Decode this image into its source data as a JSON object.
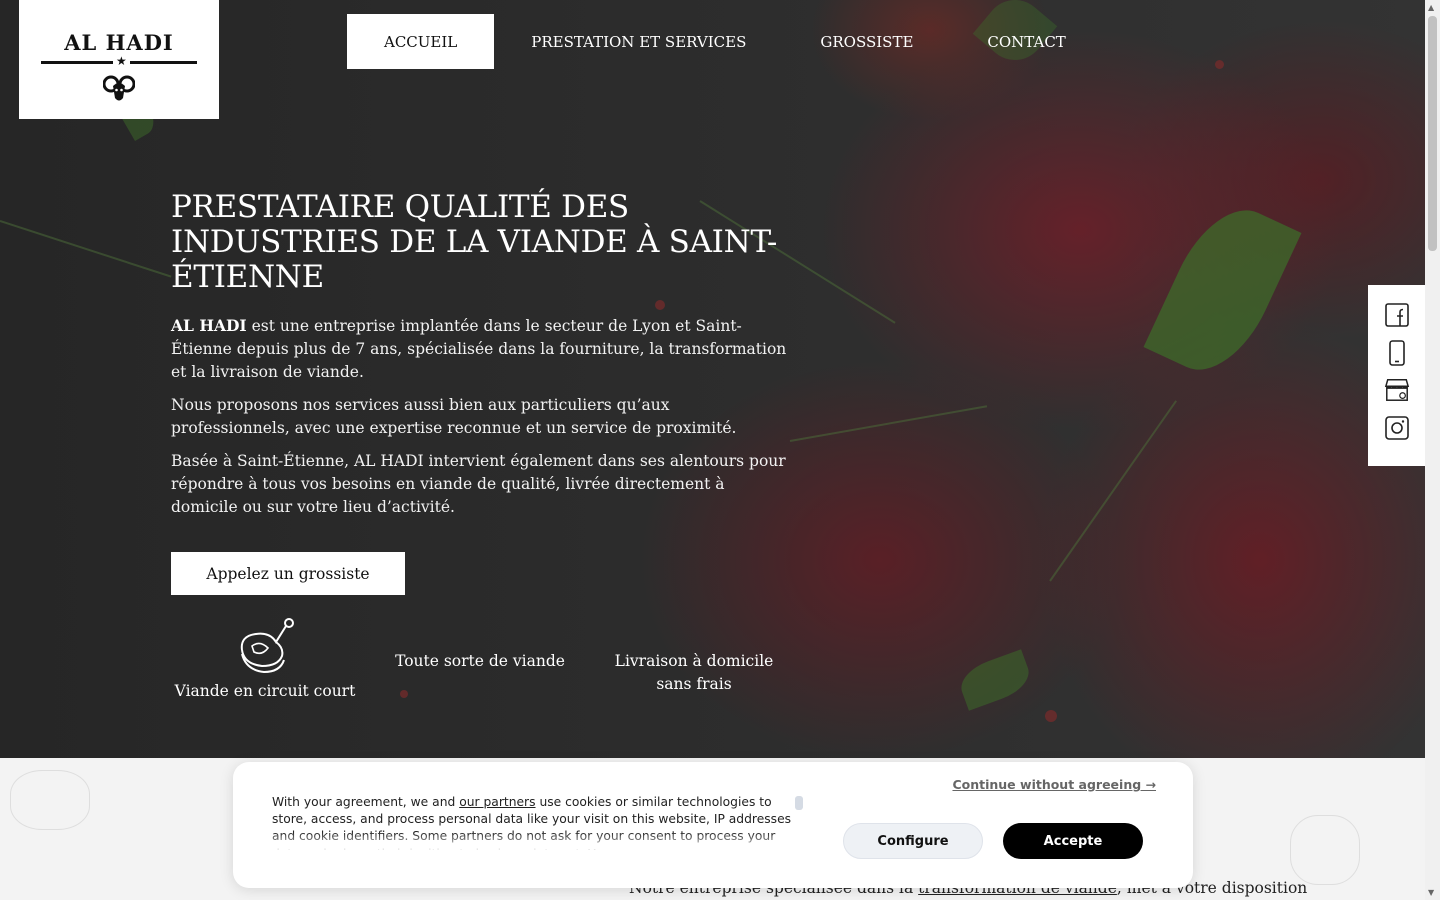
{
  "brand": {
    "name": "AL HADI"
  },
  "nav": {
    "items": [
      {
        "label": "ACCUEIL",
        "active": true
      },
      {
        "label": "PRESTATION ET SERVICES"
      },
      {
        "label": "GROSSISTE"
      },
      {
        "label": "CONTACT"
      }
    ]
  },
  "hero": {
    "title": "PRESTATAIRE QUALITÉ DES INDUSTRIES DE LA VIANDE À SAINT-ÉTIENNE",
    "intro_bold": "AL HADI",
    "intro_rest": " est une entreprise implantée dans le secteur de Lyon et Saint-Étienne depuis plus de 7 ans, spécialisée dans la fourniture, la transformation et la livraison de viande.",
    "p2": "Nous proposons nos services aussi bien aux particuliers qu’aux professionnels, avec une expertise reconnue et un service de proximité.",
    "p3": "Basée à Saint-Étienne, AL HADI intervient également dans ses alentours pour répondre à tous vos besoins en viande de qualité, livrée directement à domicile ou sur votre lieu d’activité.",
    "cta_label": "Appelez un grossiste",
    "features": [
      {
        "label": "Viande en circuit court",
        "icon": "meat-leg-icon"
      },
      {
        "label": "Toute sorte de viande"
      },
      {
        "label": "Livraison à domicile sans frais"
      }
    ]
  },
  "social": {
    "icons": [
      "facebook-icon",
      "phone-icon",
      "store-icon",
      "instagram-icon"
    ]
  },
  "lower": {
    "text_before": "Notre entreprise spécialisée dans la ",
    "text_link": "transformation de viande",
    "text_after": ", met à votre disposition"
  },
  "cookie": {
    "continue_label": "Continue without agreeing →",
    "text_before": "With your agreement, we and ",
    "text_link": "our partners",
    "text_after": " use cookies or similar technologies to store, access, and process personal data like your visit on this website, IP addresses and cookie identifiers. Some partners do not ask for your consent to process your data and rely on their legitimate business interest. You can",
    "configure_label": "Configure",
    "accept_label": "Accepte"
  },
  "colors": {
    "accent": "#000000",
    "hero_bg": "#2a2a2a"
  }
}
